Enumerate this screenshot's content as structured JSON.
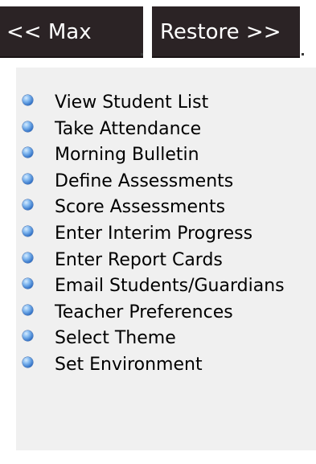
{
  "toolbar": {
    "max_label": "<< Max",
    "restore_label": "Restore >>"
  },
  "menu": {
    "bullet_icon": "blue-sphere-bullet-icon",
    "items": [
      {
        "label": "View Student List"
      },
      {
        "label": "Take Attendance"
      },
      {
        "label": "Morning Bulletin"
      },
      {
        "label": "Define Assessments"
      },
      {
        "label": "Score Assessments"
      },
      {
        "label": "Enter Interim Progress"
      },
      {
        "label": "Enter Report Cards"
      },
      {
        "label": "Email Students/Guardians"
      },
      {
        "label": "Teacher Preferences"
      },
      {
        "label": "Select Theme"
      },
      {
        "label": "Set Environment"
      }
    ]
  },
  "colors": {
    "button_bg": "#2b2325",
    "button_text": "#ffffff",
    "panel_bg": "#f0f0f0",
    "bullet": "#2f6fc4",
    "menu_text": "#000000"
  }
}
